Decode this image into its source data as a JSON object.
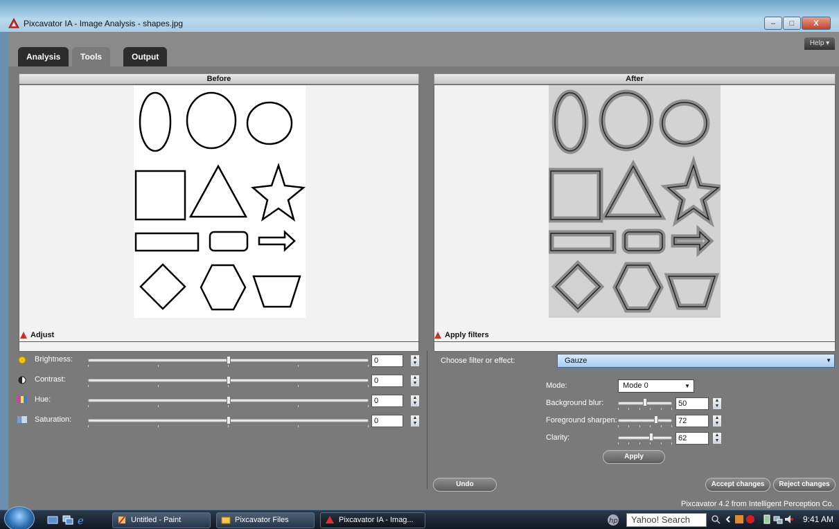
{
  "window": {
    "title": "Pixcavator IA - Image Analysis - shapes.jpg",
    "minimize": "–",
    "maximize": "□",
    "close": "X"
  },
  "tabs": [
    {
      "label": "Analysis",
      "active": false
    },
    {
      "label": "Tools",
      "active": true
    },
    {
      "label": "Output",
      "active": false
    }
  ],
  "help": "Help ▾",
  "before": {
    "title": "Before"
  },
  "after": {
    "title": "After"
  },
  "adjust": {
    "title": "Adjust",
    "sliders": [
      {
        "label": "Brightness:",
        "value": "0",
        "icon": "brightness-icon"
      },
      {
        "label": "Contrast:",
        "value": "0",
        "icon": "contrast-icon"
      },
      {
        "label": "Hue:",
        "value": "0",
        "icon": "hue-icon"
      },
      {
        "label": "Saturation:",
        "value": "0",
        "icon": "saturation-icon"
      }
    ]
  },
  "filters": {
    "title": "Apply filters",
    "choose_label": "Choose filter or effect:",
    "selected_filter": "Gauze",
    "mode_label": "Mode:",
    "mode_value": "Mode 0",
    "params": [
      {
        "label": "Background blur:",
        "value": "50",
        "level": 0.5
      },
      {
        "label": "Foreground sharpen:",
        "value": "72",
        "level": 0.72
      },
      {
        "label": "Clarity:",
        "value": "62",
        "level": 0.62
      }
    ],
    "apply": "Apply"
  },
  "buttons": {
    "undo": "Undo",
    "accept": "Accept changes",
    "reject": "Reject changes"
  },
  "footer": "Pixcavator 4.2 from Intelligent Perception Co.",
  "taskbar": {
    "tasks": [
      {
        "label": "Untitled - Paint"
      },
      {
        "label": "Pixcavator Files"
      },
      {
        "label": "Pixcavator IA - Imag..."
      }
    ],
    "search": "Yahoo! Search",
    "clock": "9:41 AM"
  },
  "colors": {
    "app_bg": "#7a7a7a",
    "accent_red": "#c0392b",
    "dropdown_blue": "#a9cdee"
  }
}
